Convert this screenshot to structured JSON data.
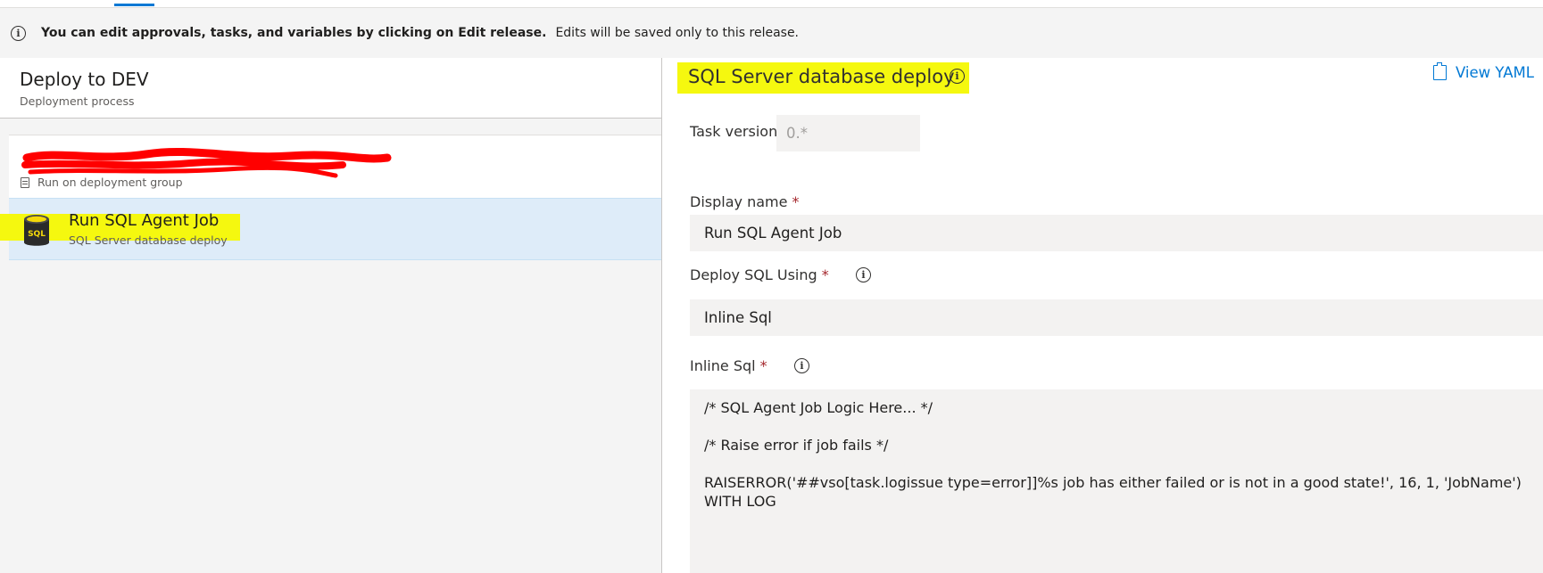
{
  "infobar": {
    "bold_text": "You can edit approvals, tasks, and variables by clicking on Edit release.",
    "normal_text": "Edits will be saved only to this release."
  },
  "left_panel": {
    "title": "Deploy to DEV",
    "subtitle": "Deployment process",
    "phase": {
      "subtitle": "Run on deployment group"
    },
    "task": {
      "name": "Run SQL Agent Job",
      "subtitle": "SQL Server database deploy",
      "icon_label": "SQL"
    }
  },
  "right_panel": {
    "title": "SQL Server database deploy",
    "view_yaml": "View YAML",
    "task_version_label": "Task version",
    "task_version_value": "0.*",
    "display_name_label": "Display name",
    "display_name_value": "Run SQL Agent Job",
    "deploy_using_label": "Deploy SQL Using",
    "deploy_using_value": "Inline Sql",
    "inline_sql_label": "Inline Sql",
    "required_marker": "*",
    "inline_sql_lines": [
      "/* SQL Agent Job Logic Here... */",
      "/* Raise error if job fails */",
      "RAISERROR('##vso[task.logissue type=error]]%s job has either failed or is not in a good state!', 16, 1, 'JobName') WITH LOG"
    ]
  },
  "info_icon_glyph": "i",
  "colors": {
    "accent": "#0078d4",
    "highlight": "#f5f80f",
    "selected_row": "#deecf9",
    "redaction": "#ff0000",
    "required": "#a4262c"
  }
}
